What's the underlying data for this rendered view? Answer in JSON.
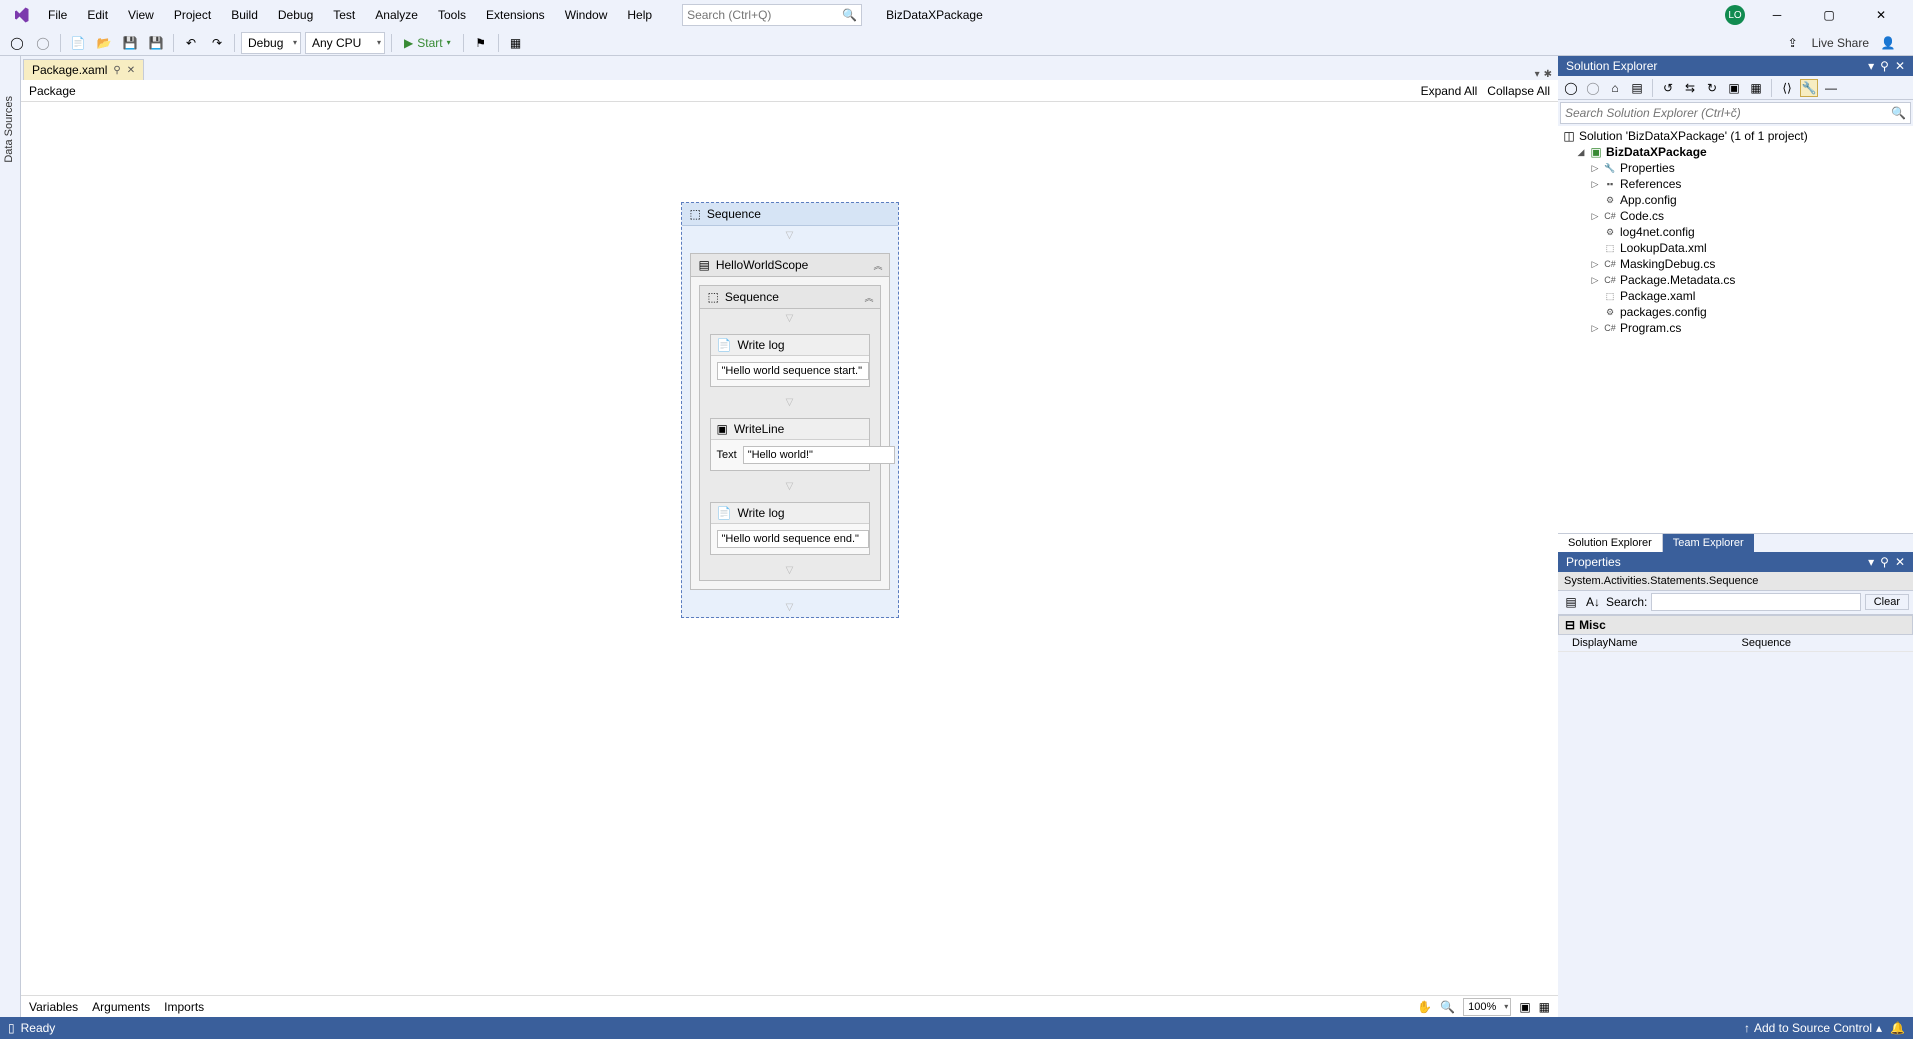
{
  "menu": [
    "File",
    "Edit",
    "View",
    "Project",
    "Build",
    "Debug",
    "Test",
    "Analyze",
    "Tools",
    "Extensions",
    "Window",
    "Help"
  ],
  "search_placeholder": "Search (Ctrl+Q)",
  "project_name": "BizDataXPackage",
  "avatar": "LO",
  "toolbar": {
    "config": "Debug",
    "platform": "Any CPU",
    "start": "Start",
    "live_share": "Live Share"
  },
  "side_tab": "Data Sources",
  "doc_tab": "Package.xaml",
  "breadcrumb": "Package",
  "expand_all": "Expand All",
  "collapse_all": "Collapse All",
  "workflow": {
    "outer": "Sequence",
    "scope": "HelloWorldScope",
    "inner": "Sequence",
    "act1": {
      "title": "Write log",
      "value": "\"Hello world sequence start.\""
    },
    "act2": {
      "title": "WriteLine",
      "label": "Text",
      "value": "\"Hello world!\""
    },
    "act3": {
      "title": "Write log",
      "value": "\"Hello world sequence end.\""
    }
  },
  "bottom_tabs": [
    "Variables",
    "Arguments",
    "Imports"
  ],
  "zoom": "100%",
  "solution_explorer": {
    "title": "Solution Explorer",
    "search_placeholder": "Search Solution Explorer (Ctrl+č)",
    "root": "Solution 'BizDataXPackage' (1 of 1 project)",
    "project": "BizDataXPackage",
    "items": [
      {
        "label": "Properties",
        "exp": "▷",
        "icon": "wrench"
      },
      {
        "label": "References",
        "exp": "▷",
        "icon": "refs"
      },
      {
        "label": "App.config",
        "exp": "",
        "icon": "cfg"
      },
      {
        "label": "Code.cs",
        "exp": "▷",
        "icon": "cs"
      },
      {
        "label": "log4net.config",
        "exp": "",
        "icon": "cfg"
      },
      {
        "label": "LookupData.xml",
        "exp": "",
        "icon": "xml"
      },
      {
        "label": "MaskingDebug.cs",
        "exp": "▷",
        "icon": "cs"
      },
      {
        "label": "Package.Metadata.cs",
        "exp": "▷",
        "icon": "cs"
      },
      {
        "label": "Package.xaml",
        "exp": "",
        "icon": "xaml"
      },
      {
        "label": "packages.config",
        "exp": "",
        "icon": "cfg"
      },
      {
        "label": "Program.cs",
        "exp": "▷",
        "icon": "cs"
      }
    ],
    "tabs": [
      "Solution Explorer",
      "Team Explorer"
    ]
  },
  "properties": {
    "title": "Properties",
    "object": "System.Activities.Statements.Sequence",
    "search_label": "Search:",
    "clear": "Clear",
    "category": "Misc",
    "rows": [
      {
        "k": "DisplayName",
        "v": "Sequence"
      }
    ]
  },
  "status": {
    "ready": "Ready",
    "add_source": "Add to Source Control"
  }
}
